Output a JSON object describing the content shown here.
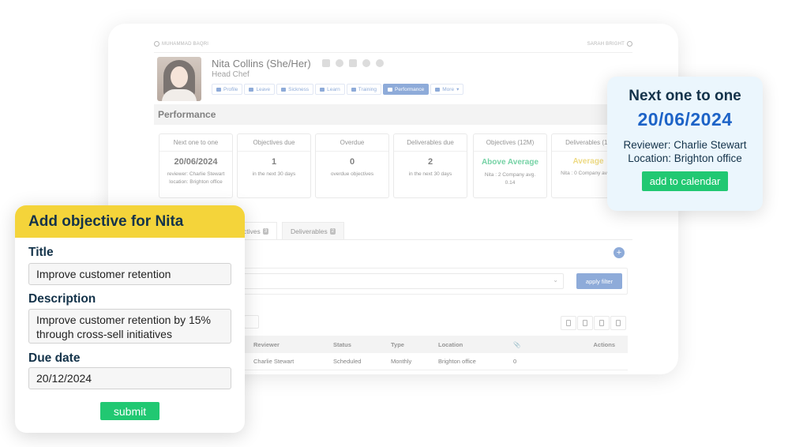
{
  "nav": {
    "prev": "MUHAMMAD BAQRI",
    "next": "SARAH BRIGHT"
  },
  "profile": {
    "name": "Nita Collins (She/Her)",
    "role": "Head Chef",
    "tabs": [
      {
        "label": "Profile",
        "icon": "user-icon"
      },
      {
        "label": "Leave",
        "icon": "plane-icon"
      },
      {
        "label": "Sickness",
        "icon": "medical-icon"
      },
      {
        "label": "Learn",
        "icon": "laptop-icon"
      },
      {
        "label": "Training",
        "icon": "training-icon"
      },
      {
        "label": "Performance",
        "icon": "gauge-icon",
        "active": true
      },
      {
        "label": "More",
        "icon": "more-icon"
      }
    ]
  },
  "section": {
    "title": "Performance"
  },
  "stats": [
    {
      "head": "Next one to one",
      "value": "20/06/2024",
      "sub": "reviewer: Charlie Stewart location: Brighton office"
    },
    {
      "head": "Objectives due",
      "value": "1",
      "sub": "in the next 30 days"
    },
    {
      "head": "Overdue",
      "value": "0",
      "sub": "overdue objectives"
    },
    {
      "head": "Deliverables due",
      "value": "2",
      "sub": "in the next 30 days"
    },
    {
      "head": "Objectives (12M)",
      "value": "Above Average",
      "sub": "Nita : 2 Company avg. 0.14"
    },
    {
      "head": "Deliverables (12",
      "value": "Average",
      "sub": "Nita : 0 Company avg. 0"
    }
  ],
  "lower_tabs": [
    {
      "label": "ctives",
      "count": "3"
    },
    {
      "label": "Deliverables",
      "count": "2"
    }
  ],
  "filter": {
    "apply_label": "apply filter"
  },
  "table": {
    "headers": [
      "Reviewer",
      "Status",
      "Type",
      "Location",
      "Actions"
    ],
    "rows": [
      {
        "reviewer": "Charlie Stewart",
        "status": "Scheduled",
        "type": "Monthly",
        "location": "Brighton office",
        "attachments": "0"
      }
    ]
  },
  "popup_next": {
    "title": "Next one to one",
    "date": "20/06/2024",
    "reviewer": "Reviewer: Charlie Stewart",
    "location": "Location: Brighton office",
    "button": "add to calendar"
  },
  "popup_add": {
    "header": "Add objective for Nita",
    "title_label": "Title",
    "title_value": "Improve customer retention",
    "description_label": "Description",
    "description_value": "Improve customer retention by 15% through cross-sell initiatives",
    "due_label": "Due date",
    "due_value": "20/12/2024",
    "submit": "submit"
  },
  "colors": {
    "accent_blue": "#4a78c2",
    "green": "#21c872",
    "yellow": "#f4d43a",
    "navy": "#14334a",
    "date_blue": "#1d63c7"
  }
}
